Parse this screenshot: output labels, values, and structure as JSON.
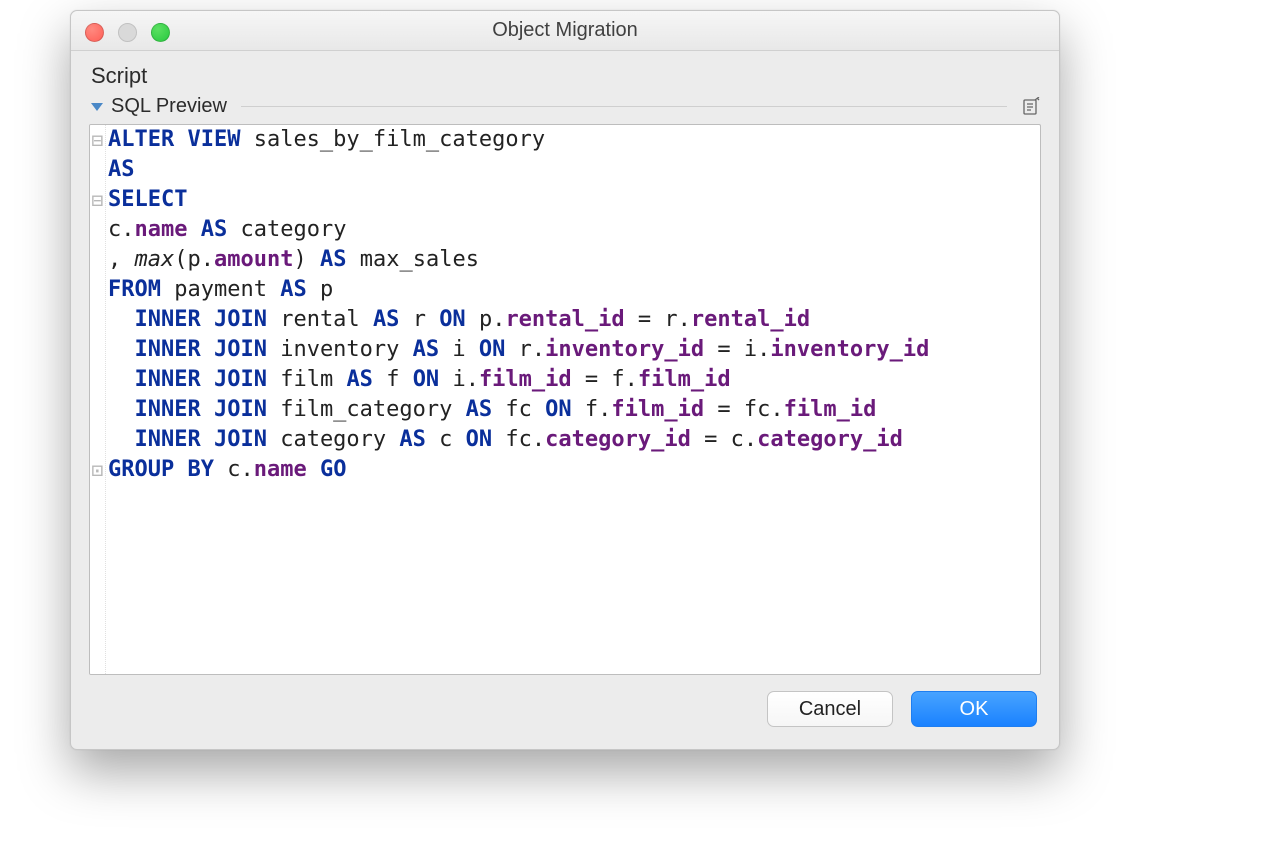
{
  "window": {
    "title": "Object Migration"
  },
  "section": {
    "label": "Script",
    "sublabel": "SQL Preview",
    "edit_icon_name": "edit-document-icon"
  },
  "buttons": {
    "cancel": "Cancel",
    "ok": "OK"
  },
  "sql": {
    "tokens": [
      [
        {
          "t": "fold",
          "v": "⊟"
        }
      ],
      [
        {
          "t": "kw",
          "v": "ALTER VIEW"
        },
        {
          "t": "sp",
          "v": " "
        },
        {
          "t": "ident",
          "v": "sales_by_film_category"
        }
      ],
      [
        {
          "t": "kw",
          "v": "AS"
        }
      ],
      [
        {
          "t": "fold",
          "v": "⊟"
        }
      ],
      [
        {
          "t": "kw",
          "v": "SELECT"
        }
      ],
      [
        {
          "t": "ident",
          "v": "c"
        },
        {
          "t": "punct",
          "v": "."
        },
        {
          "t": "field",
          "v": "name"
        },
        {
          "t": "sp",
          "v": " "
        },
        {
          "t": "kw",
          "v": "AS"
        },
        {
          "t": "sp",
          "v": " "
        },
        {
          "t": "ident",
          "v": "category"
        }
      ],
      [
        {
          "t": "punct",
          "v": ","
        },
        {
          "t": "sp",
          "v": " "
        },
        {
          "t": "func",
          "v": "max"
        },
        {
          "t": "punct",
          "v": "("
        },
        {
          "t": "ident",
          "v": "p"
        },
        {
          "t": "punct",
          "v": "."
        },
        {
          "t": "field",
          "v": "amount"
        },
        {
          "t": "punct",
          "v": ")"
        },
        {
          "t": "sp",
          "v": " "
        },
        {
          "t": "kw",
          "v": "AS"
        },
        {
          "t": "sp",
          "v": " "
        },
        {
          "t": "ident",
          "v": "max_sales"
        }
      ],
      [
        {
          "t": "kw",
          "v": "FROM"
        },
        {
          "t": "sp",
          "v": " "
        },
        {
          "t": "ident",
          "v": "payment"
        },
        {
          "t": "sp",
          "v": " "
        },
        {
          "t": "kw",
          "v": "AS"
        },
        {
          "t": "sp",
          "v": " "
        },
        {
          "t": "ident",
          "v": "p"
        }
      ],
      [
        {
          "t": "indent",
          "v": "  "
        },
        {
          "t": "kw",
          "v": "INNER JOIN"
        },
        {
          "t": "sp",
          "v": " "
        },
        {
          "t": "ident",
          "v": "rental"
        },
        {
          "t": "sp",
          "v": " "
        },
        {
          "t": "kw",
          "v": "AS"
        },
        {
          "t": "sp",
          "v": " "
        },
        {
          "t": "ident",
          "v": "r"
        },
        {
          "t": "sp",
          "v": " "
        },
        {
          "t": "kw",
          "v": "ON"
        },
        {
          "t": "sp",
          "v": " "
        },
        {
          "t": "ident",
          "v": "p"
        },
        {
          "t": "punct",
          "v": "."
        },
        {
          "t": "field",
          "v": "rental_id"
        },
        {
          "t": "sp",
          "v": " "
        },
        {
          "t": "punct",
          "v": "="
        },
        {
          "t": "sp",
          "v": " "
        },
        {
          "t": "ident",
          "v": "r"
        },
        {
          "t": "punct",
          "v": "."
        },
        {
          "t": "field",
          "v": "rental_id"
        }
      ],
      [
        {
          "t": "indent",
          "v": "  "
        },
        {
          "t": "kw",
          "v": "INNER JOIN"
        },
        {
          "t": "sp",
          "v": " "
        },
        {
          "t": "ident",
          "v": "inventory"
        },
        {
          "t": "sp",
          "v": " "
        },
        {
          "t": "kw",
          "v": "AS"
        },
        {
          "t": "sp",
          "v": " "
        },
        {
          "t": "ident",
          "v": "i"
        },
        {
          "t": "sp",
          "v": " "
        },
        {
          "t": "kw",
          "v": "ON"
        },
        {
          "t": "sp",
          "v": " "
        },
        {
          "t": "ident",
          "v": "r"
        },
        {
          "t": "punct",
          "v": "."
        },
        {
          "t": "field",
          "v": "inventory_id"
        },
        {
          "t": "sp",
          "v": " "
        },
        {
          "t": "punct",
          "v": "="
        },
        {
          "t": "sp",
          "v": " "
        },
        {
          "t": "ident",
          "v": "i"
        },
        {
          "t": "punct",
          "v": "."
        },
        {
          "t": "field",
          "v": "inventory_id"
        }
      ],
      [
        {
          "t": "indent",
          "v": "  "
        },
        {
          "t": "kw",
          "v": "INNER JOIN"
        },
        {
          "t": "sp",
          "v": " "
        },
        {
          "t": "ident",
          "v": "film"
        },
        {
          "t": "sp",
          "v": " "
        },
        {
          "t": "kw",
          "v": "AS"
        },
        {
          "t": "sp",
          "v": " "
        },
        {
          "t": "ident",
          "v": "f"
        },
        {
          "t": "sp",
          "v": " "
        },
        {
          "t": "kw",
          "v": "ON"
        },
        {
          "t": "sp",
          "v": " "
        },
        {
          "t": "ident",
          "v": "i"
        },
        {
          "t": "punct",
          "v": "."
        },
        {
          "t": "field",
          "v": "film_id"
        },
        {
          "t": "sp",
          "v": " "
        },
        {
          "t": "punct",
          "v": "="
        },
        {
          "t": "sp",
          "v": " "
        },
        {
          "t": "ident",
          "v": "f"
        },
        {
          "t": "punct",
          "v": "."
        },
        {
          "t": "field",
          "v": "film_id"
        }
      ],
      [
        {
          "t": "indent",
          "v": "  "
        },
        {
          "t": "kw",
          "v": "INNER JOIN"
        },
        {
          "t": "sp",
          "v": " "
        },
        {
          "t": "ident",
          "v": "film_category"
        },
        {
          "t": "sp",
          "v": " "
        },
        {
          "t": "kw",
          "v": "AS"
        },
        {
          "t": "sp",
          "v": " "
        },
        {
          "t": "ident",
          "v": "fc"
        },
        {
          "t": "sp",
          "v": " "
        },
        {
          "t": "kw",
          "v": "ON"
        },
        {
          "t": "sp",
          "v": " "
        },
        {
          "t": "ident",
          "v": "f"
        },
        {
          "t": "punct",
          "v": "."
        },
        {
          "t": "field",
          "v": "film_id"
        },
        {
          "t": "sp",
          "v": " "
        },
        {
          "t": "punct",
          "v": "="
        },
        {
          "t": "sp",
          "v": " "
        },
        {
          "t": "ident",
          "v": "fc"
        },
        {
          "t": "punct",
          "v": "."
        },
        {
          "t": "field",
          "v": "film_id"
        }
      ],
      [
        {
          "t": "indent",
          "v": "  "
        },
        {
          "t": "kw",
          "v": "INNER JOIN"
        },
        {
          "t": "sp",
          "v": " "
        },
        {
          "t": "ident",
          "v": "category"
        },
        {
          "t": "sp",
          "v": " "
        },
        {
          "t": "kw",
          "v": "AS"
        },
        {
          "t": "sp",
          "v": " "
        },
        {
          "t": "ident",
          "v": "c"
        },
        {
          "t": "sp",
          "v": " "
        },
        {
          "t": "kw",
          "v": "ON"
        },
        {
          "t": "sp",
          "v": " "
        },
        {
          "t": "ident",
          "v": "fc"
        },
        {
          "t": "punct",
          "v": "."
        },
        {
          "t": "field",
          "v": "category_id"
        },
        {
          "t": "sp",
          "v": " "
        },
        {
          "t": "punct",
          "v": "="
        },
        {
          "t": "sp",
          "v": " "
        },
        {
          "t": "ident",
          "v": "c"
        },
        {
          "t": "punct",
          "v": "."
        },
        {
          "t": "field",
          "v": "category_id"
        }
      ],
      [
        {
          "t": "fold",
          "v": "⊡"
        }
      ],
      [
        {
          "t": "kw",
          "v": "GROUP BY"
        },
        {
          "t": "sp",
          "v": " "
        },
        {
          "t": "ident",
          "v": "c"
        },
        {
          "t": "punct",
          "v": "."
        },
        {
          "t": "field",
          "v": "name"
        },
        {
          "t": "sp",
          "v": " "
        },
        {
          "t": "kw",
          "v": "GO"
        }
      ]
    ],
    "gutter_fold_lines": [
      0,
      2,
      13
    ]
  }
}
